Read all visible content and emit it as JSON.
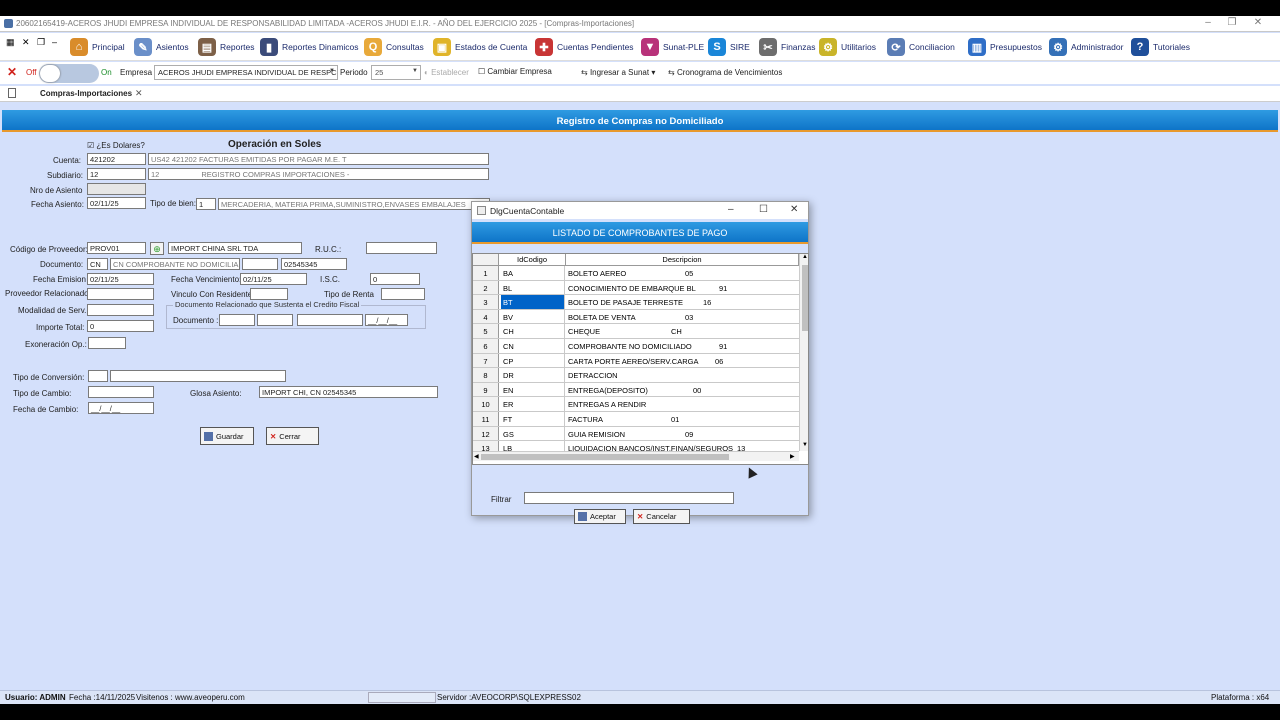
{
  "window": {
    "title": "20602165419-ACEROS JHUDI EMPRESA INDIVIDUAL DE RESPONSABILIDAD LIMITADA -ACEROS JHUDI E.I.R. - AÑO DEL EJERCICIO 2025 - [Compras-Importaciones]",
    "minimize": "–",
    "maximize": "❐",
    "close": "✕"
  },
  "menu": [
    {
      "label": "Principal",
      "icon": "home-icon",
      "color": "#d98c2b",
      "glyph": "⌂"
    },
    {
      "label": "Asientos",
      "icon": "edit-icon",
      "color": "#6a8fc9",
      "glyph": "✎"
    },
    {
      "label": "Reportes",
      "icon": "report-icon",
      "color": "#7d6048",
      "glyph": "▤"
    },
    {
      "label": "Reportes Dinamicos",
      "icon": "chart-icon",
      "color": "#3b4b7a",
      "glyph": "▮"
    },
    {
      "label": "Consultas",
      "icon": "search-icon",
      "color": "#e8a93a",
      "glyph": "Q"
    },
    {
      "label": "Estados de Cuenta",
      "icon": "clipboard-icon",
      "color": "#e0b42a",
      "glyph": "▣"
    },
    {
      "label": "Cuentas Pendientes",
      "icon": "lifebuoy-icon",
      "color": "#c83535",
      "glyph": "✚"
    },
    {
      "label": "Sunat-PLE",
      "icon": "bottle-icon",
      "color": "#b8327a",
      "glyph": "▼"
    },
    {
      "label": "SIRE",
      "icon": "sire-icon",
      "color": "#1a86d8",
      "glyph": "S"
    },
    {
      "label": "Finanzas",
      "icon": "tools-icon",
      "color": "#6d6d6d",
      "glyph": "✂"
    },
    {
      "label": "Utilitarios",
      "icon": "utilities-icon",
      "color": "#c9b42a",
      "glyph": "⚙"
    },
    {
      "label": "Conciliacion",
      "icon": "refresh-icon",
      "color": "#5b7db5",
      "glyph": "⟳"
    },
    {
      "label": "Presupuestos",
      "icon": "budget-icon",
      "color": "#2f6ec7",
      "glyph": "▥"
    },
    {
      "label": "Administrador",
      "icon": "gear-icon",
      "color": "#3470b7",
      "glyph": "⚙"
    },
    {
      "label": "Tutoriales",
      "icon": "help-icon",
      "color": "#1f4f9a",
      "glyph": "?"
    }
  ],
  "toolbar": {
    "off": "Off",
    "on": "On",
    "empresa_label": "Empresa",
    "empresa_value": "ACEROS JHUDI EMPRESA INDIVIDUAL DE RESPC",
    "periodo_label": "Periodo",
    "periodo_value": "25",
    "establecer": "Establecer",
    "cambiar_empresa": "Cambiar Empresa",
    "ingresar_sunat": "Ingresar a Sunat",
    "cronograma": "Cronograma de Vencimientos"
  },
  "tab": {
    "label": "Compras-Importaciones",
    "close": "✕"
  },
  "header": {
    "title": "Registro de Compras no Domiciliado"
  },
  "form": {
    "es_dolares": "¿Es Dolares?",
    "operacion": "Operación en Soles",
    "cuenta_label": "Cuenta:",
    "cuenta_value": "421202",
    "cuenta_desc": "US42    421202     FACTURAS EMITIDAS POR PAGAR M.E. T",
    "subdiario_label": "Subdiario:",
    "subdiario_value": "12",
    "subdiario_code": "12",
    "subdiario_desc": "REGISTRO COMPRAS IMPORTACIONES -",
    "nro_asiento_label": "Nro  de Asiento",
    "fecha_asiento_label": "Fecha Asiento:",
    "fecha_asiento_value": "02/11/25",
    "tipo_bien_label": "Tipo de bien:",
    "tipo_bien_value": "1",
    "tipo_bien_desc": "MERCADERIA, MATERIA PRIMA,SUMINISTRO,ENVASES EMBALAJES",
    "cod_proveedor_label": "Código de Proveedor:",
    "cod_proveedor_value": "PROV01",
    "proveedor_name": "IMPORT CHINA SRL TDA",
    "ruc_label": "R.U.C.:",
    "documento_label": "Documento:",
    "doc_code": "CN",
    "doc_desc": "CN      COMPROBANTE NO DOMICILIA",
    "doc_number": "02545345",
    "fecha_emision_label": "Fecha Emision",
    "fecha_emision_value": "02/11/25",
    "fecha_venc_label": "Fecha Vencimiento:",
    "fecha_venc_value": "02/11/25",
    "isc_label": "I.S.C.",
    "isc_value": "0",
    "prov_rel_label": "Proveedor Relacionado",
    "vinculo_label": "Vinculo Con Residente:",
    "tipo_renta_label": "Tipo de Renta",
    "modalidad_label": "Modalidad de Serv.",
    "doc_rel_group": "Documento Relacionado que Sustenta el Credito Fiscal",
    "doc_rel_label": "Documento :",
    "doc_rel_date": "__/__/__",
    "importe_label": "Importe Total:",
    "importe_value": "0",
    "exoneracion_label": "Exoneración Op.:",
    "tipo_conversion_label": "Tipo de Conversión:",
    "tipo_cambio_label": "Tipo de Cambio:",
    "glosa_label": "Glosa Asiento:",
    "glosa_value": "IMPORT CHI, CN 02545345",
    "fecha_cambio_label": "Fecha de Cambio:",
    "fecha_cambio_value": "__/__/__",
    "guardar": "Guardar",
    "cerrar": "Cerrar"
  },
  "dialog": {
    "title": "DlgCuentaContable",
    "minimize": "–",
    "maximize": "☐",
    "close": "✕",
    "header": "LISTADO DE COMPROBANTES DE PAGO",
    "col_code": "IdCodigo",
    "col_desc": "Descripcion",
    "rows": [
      {
        "n": "1",
        "code": "BA",
        "desc": "BOLETO AEREO",
        "val": "05"
      },
      {
        "n": "2",
        "code": "BL",
        "desc": "CONOCIMIENTO DE EMBARQUE BL",
        "val": "91"
      },
      {
        "n": "3",
        "code": "BT",
        "desc": "BOLETO DE PASAJE TERRESTE",
        "val": "16"
      },
      {
        "n": "4",
        "code": "BV",
        "desc": "BOLETA DE VENTA",
        "val": "03"
      },
      {
        "n": "5",
        "code": "CH",
        "desc": "CHEQUE",
        "val": "CH"
      },
      {
        "n": "6",
        "code": "CN",
        "desc": "COMPROBANTE NO DOMICILIADO",
        "val": "91"
      },
      {
        "n": "7",
        "code": "CP",
        "desc": "CARTA PORTE AEREO/SERV.CARGA",
        "val": "06"
      },
      {
        "n": "8",
        "code": "DR",
        "desc": "DETRACCION",
        "val": ""
      },
      {
        "n": "9",
        "code": "EN",
        "desc": "ENTREGA(DEPOSITO)",
        "val": "00"
      },
      {
        "n": "10",
        "code": "ER",
        "desc": "ENTREGAS A RENDIR",
        "val": ""
      },
      {
        "n": "11",
        "code": "FT",
        "desc": "FACTURA",
        "val": "01"
      },
      {
        "n": "12",
        "code": "GS",
        "desc": "GUIA REMISION",
        "val": "09"
      },
      {
        "n": "13",
        "code": "LB",
        "desc": "LIQUIDACION BANCOS/INST.FINAN/SEGUROS",
        "val": "13"
      }
    ],
    "filtrar": "Filtrar",
    "aceptar": "Aceptar",
    "cancelar": "Cancelar"
  },
  "status": {
    "usuario": "Usuario: ADMIN",
    "fecha": "Fecha :14/11/2025",
    "visitenos": "Visitenos : www.aveoperu.com",
    "servidor": "Servidor :AVEOCORP\\SQLEXPRESS02",
    "plataforma": "Plataforma : x64"
  }
}
